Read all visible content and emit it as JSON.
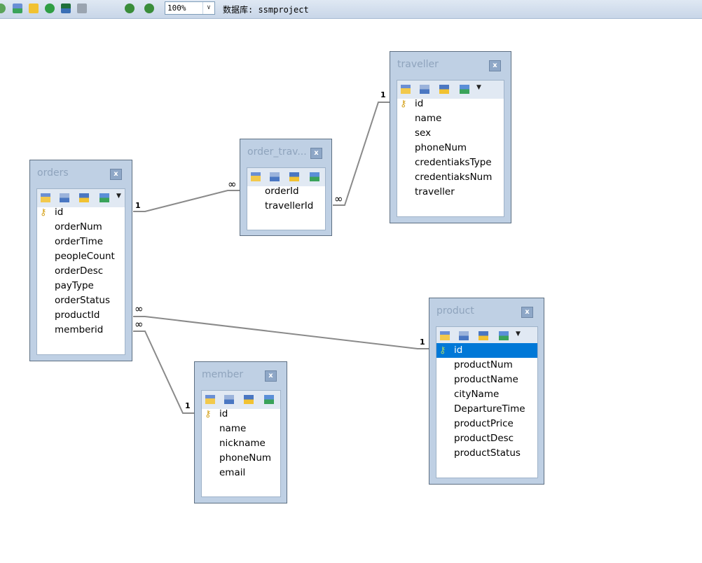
{
  "toolbar": {
    "zoom": "100%",
    "database_label": "数据库: ssmproject",
    "icons": [
      "refresh-icon",
      "add-table-icon",
      "open-folder-icon",
      "run-icon",
      "export-icon",
      "print-icon",
      "zoom-in-icon",
      "zoom-out-icon"
    ]
  },
  "tables": {
    "orders": {
      "title": "orders",
      "close": "x",
      "fields": [
        "id",
        "orderNum",
        "orderTime",
        "peopleCount",
        "orderDesc",
        "payType",
        "orderStatus",
        "productId",
        "memberid"
      ]
    },
    "order_traveller": {
      "title": "order_trav...",
      "close": "x",
      "fields": [
        "orderId",
        "travellerId"
      ]
    },
    "traveller": {
      "title": "traveller",
      "close": "x",
      "fields": [
        "id",
        "name",
        "sex",
        "phoneNum",
        "credentiaksType",
        "credentiaksNum",
        "traveller"
      ]
    },
    "product": {
      "title": "product",
      "close": "x",
      "fields": [
        "id",
        "productNum",
        "productName",
        "cityName",
        "DepartureTime",
        "productPrice",
        "productDesc",
        "productStatus"
      ]
    },
    "member": {
      "title": "member",
      "close": "x",
      "fields": [
        "id",
        "name",
        "nickname",
        "phoneNum",
        "email"
      ]
    }
  },
  "relations": {
    "one": "1",
    "many": "∞"
  },
  "colors": {
    "line": "#8a8a8a",
    "selection": "#0078d7",
    "panel": "#bfd0e4"
  }
}
